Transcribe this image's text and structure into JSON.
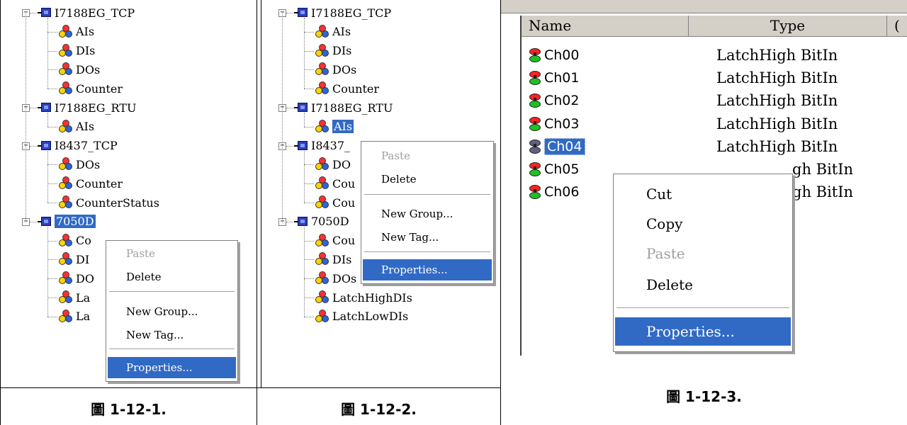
{
  "panel1": {
    "tree": [
      {
        "label": "I7188EG_TCP",
        "kind": "device",
        "expander": "⊟"
      },
      {
        "label": "AIs",
        "kind": "group"
      },
      {
        "label": "DIs",
        "kind": "group"
      },
      {
        "label": "DOs",
        "kind": "group"
      },
      {
        "label": "Counter",
        "kind": "group"
      },
      {
        "label": "I7188EG_RTU",
        "kind": "device",
        "expander": "⊟"
      },
      {
        "label": "AIs",
        "kind": "group"
      },
      {
        "label": "I8437_TCP",
        "kind": "device",
        "expander": "⊟"
      },
      {
        "label": "DOs",
        "kind": "group"
      },
      {
        "label": "Counter",
        "kind": "group"
      },
      {
        "label": "CounterStatus",
        "kind": "group"
      },
      {
        "label": "7050D",
        "kind": "device",
        "expander": "⊟",
        "selected": true
      },
      {
        "label": "Co",
        "kind": "group"
      },
      {
        "label": "DI",
        "kind": "group"
      },
      {
        "label": "DO",
        "kind": "group"
      },
      {
        "label": "La",
        "kind": "group"
      },
      {
        "label": "La",
        "kind": "group"
      }
    ],
    "menu": {
      "paste": "Paste",
      "delete": "Delete",
      "new_group": "New Group...",
      "new_tag": "New Tag...",
      "properties": "Properties..."
    },
    "caption": "圖 1-12-1."
  },
  "panel2": {
    "tree": [
      {
        "label": "I7188EG_TCP",
        "kind": "device"
      },
      {
        "label": "AIs",
        "kind": "group"
      },
      {
        "label": "DIs",
        "kind": "group"
      },
      {
        "label": "DOs",
        "kind": "group"
      },
      {
        "label": "Counter",
        "kind": "group"
      },
      {
        "label": "I7188EG_RTU",
        "kind": "device"
      },
      {
        "label": "AIs",
        "kind": "group",
        "selected": true
      },
      {
        "label": "I8437_",
        "kind": "device"
      },
      {
        "label": "DO",
        "kind": "group"
      },
      {
        "label": "Cou",
        "kind": "group"
      },
      {
        "label": "Cou",
        "kind": "group"
      },
      {
        "label": "7050D",
        "kind": "device"
      },
      {
        "label": "Cou",
        "kind": "group"
      },
      {
        "label": "DIs",
        "kind": "group"
      },
      {
        "label": "DOs",
        "kind": "group"
      },
      {
        "label": "LatchHighDIs",
        "kind": "group"
      },
      {
        "label": "LatchLowDIs",
        "kind": "group"
      }
    ],
    "menu": {
      "paste": "Paste",
      "delete": "Delete",
      "new_group": "New Group...",
      "new_tag": "New Tag...",
      "properties": "Properties..."
    },
    "caption": "圖 1-12-2."
  },
  "panel3": {
    "headers": {
      "name": "Name",
      "type": "Type",
      "extra": "("
    },
    "rows": [
      {
        "name": "Ch00",
        "type": "LatchHigh BitIn"
      },
      {
        "name": "Ch01",
        "type": "LatchHigh BitIn"
      },
      {
        "name": "Ch02",
        "type": "LatchHigh BitIn"
      },
      {
        "name": "Ch03",
        "type": "LatchHigh BitIn"
      },
      {
        "name": "Ch04",
        "type": "LatchHigh BitIn",
        "selected": true
      },
      {
        "name": "Ch05",
        "type": "gh BitIn"
      },
      {
        "name": "Ch06",
        "type": "gh BitIn"
      }
    ],
    "menu": {
      "cut": "Cut",
      "copy": "Copy",
      "paste": "Paste",
      "delete": "Delete",
      "properties": "Properties..."
    },
    "caption": "圖 1-12-3.",
    "colors": {
      "highlight": "#316ac5",
      "red": "#ff2020",
      "green": "#20c020",
      "gray": "#606080"
    }
  }
}
